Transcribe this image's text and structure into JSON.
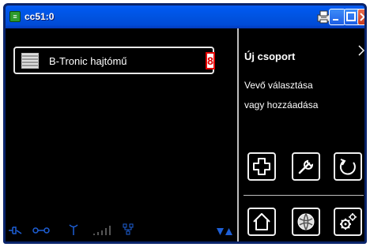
{
  "window": {
    "title": "cc51:0",
    "app_icon_glyph": "≡"
  },
  "list": {
    "items": [
      {
        "label": "B-Tronic hajtómű",
        "badge": "8",
        "icon": "blinds-icon"
      }
    ]
  },
  "panel": {
    "title": "Új csoport",
    "description_line1": "Vevő választása",
    "description_line2": "vagy hozzáadása"
  },
  "actions": {
    "add": "plus-icon",
    "edit": "wrench-icon",
    "back": "undo-icon",
    "home": "home-icon",
    "globe": "globe-icon",
    "settings": "gears-icon"
  },
  "status": {
    "icons": [
      "connection-icon",
      "link-icon",
      "antenna-icon",
      "signal-icon",
      "network-icon",
      "scroll-arrows-icon"
    ]
  },
  "colors": {
    "titlebar": "#0055e5",
    "accent_blue": "#1e5fd6",
    "badge_red": "#e30000",
    "panel_bg": "#000000"
  }
}
